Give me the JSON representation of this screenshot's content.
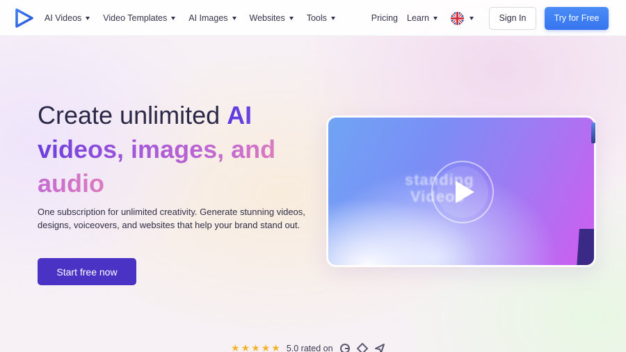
{
  "nav": {
    "items": [
      {
        "label": "AI Videos"
      },
      {
        "label": "Video Templates"
      },
      {
        "label": "AI Images"
      },
      {
        "label": "Websites"
      },
      {
        "label": "Tools"
      }
    ],
    "pricing": "Pricing",
    "learn": "Learn",
    "language_icon": "uk-flag-icon",
    "sign_in": "Sign In",
    "try_free": "Try for Free"
  },
  "hero": {
    "headline_plain": "Create unlimited ",
    "headline_ai": "AI",
    "headline_media": "videos, images,",
    "headline_and": "and",
    "headline_audio": "audio",
    "subtitle": "One subscription for unlimited creativity. Generate stunning videos, designs, voiceovers, and websites that help your brand stand out.",
    "cta": "Start free now"
  },
  "video": {
    "overlay_text_1": "standing",
    "overlay_text_2": "Videos",
    "play_icon": "play-icon"
  },
  "rating": {
    "stars": 5,
    "text": "5.0 rated on",
    "badge_icons": [
      "g2-icon",
      "capterra-icon",
      "producthunt-icon"
    ]
  },
  "colors": {
    "accent_blue": "#3774ee",
    "cta_purple": "#4a33c4",
    "star": "#f2b32c"
  }
}
